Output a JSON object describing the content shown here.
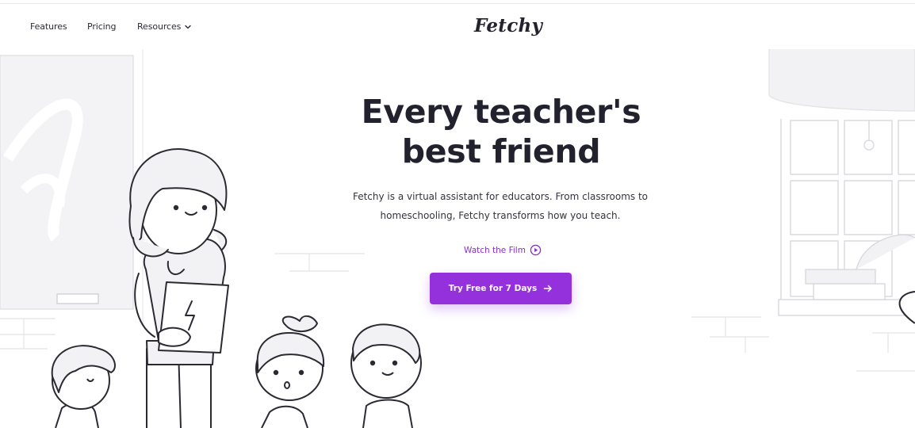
{
  "nav": {
    "features": "Features",
    "pricing": "Pricing",
    "resources": "Resources"
  },
  "brand": {
    "logo_text": "Fetchy"
  },
  "hero": {
    "title_line1": "Every teacher's",
    "title_line2": "best friend",
    "desc_line1": "Fetchy is a virtual assistant for educators. From classrooms to",
    "desc_line2": "homeschooling, Fetchy transforms how you teach.",
    "watch_label": "Watch the Film",
    "cta_label": "Try Free for 7 Days"
  },
  "colors": {
    "accent": "#9530dd",
    "link": "#8a2bd6",
    "text_dark": "#22222f",
    "illustration_fill": "#f2f2f4"
  },
  "icons": [
    "chevron-down-icon",
    "play-circle-icon",
    "arrow-right-icon"
  ]
}
